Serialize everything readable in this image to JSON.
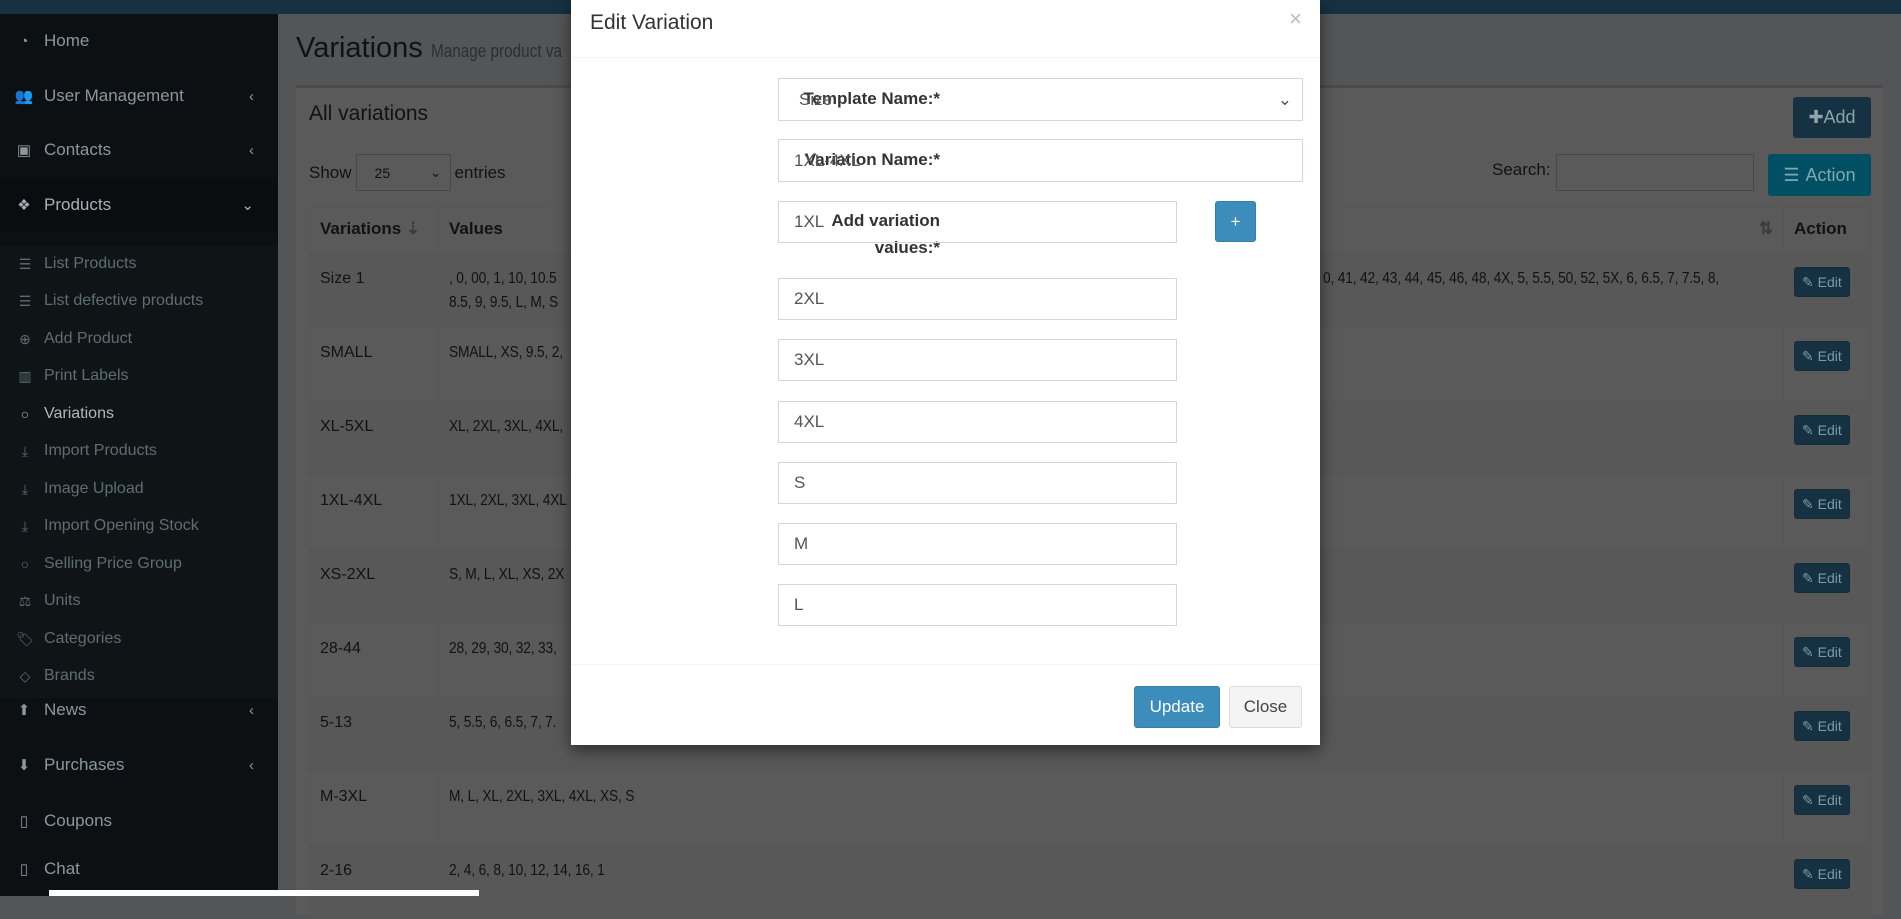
{
  "sidebar": {
    "items": [
      {
        "label": "Home",
        "icon": "dashboard-icon"
      },
      {
        "label": "User Management",
        "icon": "users-icon"
      },
      {
        "label": "Contacts",
        "icon": "address-book-icon"
      },
      {
        "label": "Products",
        "icon": "cubes-icon"
      }
    ],
    "submenu": [
      {
        "label": "List Products"
      },
      {
        "label": "List defective products"
      },
      {
        "label": "Add Product"
      },
      {
        "label": "Print Labels"
      },
      {
        "label": "Variations"
      },
      {
        "label": "Import Products"
      },
      {
        "label": "Image Upload"
      },
      {
        "label": "Import Opening Stock"
      },
      {
        "label": "Selling Price Group"
      },
      {
        "label": "Units"
      },
      {
        "label": "Categories"
      },
      {
        "label": "Brands"
      }
    ],
    "bottom_items": [
      {
        "label": "News"
      },
      {
        "label": "Purchases"
      },
      {
        "label": "Coupons"
      },
      {
        "label": "Chat"
      }
    ]
  },
  "page": {
    "title": "Variations",
    "subtitle": "Manage product va"
  },
  "box": {
    "title": "All variations",
    "add_label": "Add",
    "show_label": "Show",
    "entries_value": "25",
    "entries_label": "entries",
    "search_label": "Search:",
    "search_value": "",
    "action_label": "Action"
  },
  "table": {
    "headers": [
      "Variations",
      "Values",
      "Action"
    ],
    "edit_label": "Edit",
    "rows": [
      {
        "name": "Size 1",
        "values": ", 0, 00, 1, 10, 10.5",
        "values_right": "0, 41, 42, 43, 44, 45, 46, 48, 4X, 5, 5.5, 50, 52, 5X, 6, 6.5, 7, 7.5, 8,",
        "values_line2": "8.5, 9, 9.5, L, M, S"
      },
      {
        "name": "SMALL",
        "values": "SMALL, XS, 9.5, 2,"
      },
      {
        "name": "XL-5XL",
        "values": "XL, 2XL, 3XL, 4XL,"
      },
      {
        "name": "1XL-4XL",
        "values": "1XL, 2XL, 3XL, 4XL"
      },
      {
        "name": "XS-2XL",
        "values": "S, M, L, XL, XS, 2X"
      },
      {
        "name": "28-44",
        "values": "28, 29, 30, 32, 33,"
      },
      {
        "name": "5-13",
        "values": "5, 5.5, 6, 6.5, 7, 7."
      },
      {
        "name": "M-3XL",
        "values": "M, L, XL, 2XL, 3XL, 4XL, XS, S"
      },
      {
        "name": "2-16",
        "values": "2, 4, 6, 8, 10, 12, 14, 16, 1"
      }
    ]
  },
  "modal": {
    "title": "Edit Variation",
    "close_icon": "×",
    "template_label": "Template Name:*",
    "template_value": "Size",
    "variation_label": "Variation Name:*",
    "variation_value": "1XL-4XL",
    "values_label": "Add variation values:*",
    "plus_label": "+",
    "values": [
      "1XL",
      "2XL",
      "3XL",
      "4XL",
      "S",
      "M",
      "L"
    ],
    "update_label": "Update",
    "close_label": "Close"
  },
  "colors": {
    "primary": "#3c8dbc",
    "info": "#00c0ef",
    "sidebar": "#222d32"
  }
}
